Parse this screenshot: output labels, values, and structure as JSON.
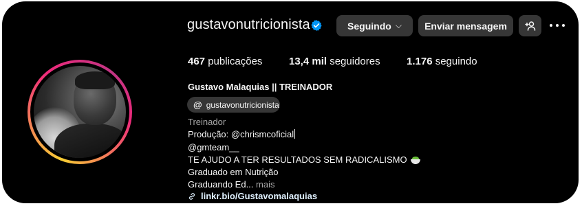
{
  "profile": {
    "username": "gustavonutricionista",
    "verified": true,
    "full_name": "Gustavo Malaquias || TREINADOR",
    "threads_handle": "gustavonutricionista",
    "category": "Treinador"
  },
  "actions": {
    "following_label": "Seguindo",
    "message_label": "Enviar mensagem",
    "suggest_icon": "add-person-icon",
    "more_icon": "more-options-icon"
  },
  "stats": {
    "posts_count": "467",
    "posts_label": "publicações",
    "followers_count": "13,4 mil",
    "followers_label": "seguidores",
    "following_count": "1.176",
    "following_label": "seguindo"
  },
  "bio": {
    "line1": "Produção: @chrismcoficial",
    "line2": "@gmteam__",
    "line3": "TE AJUDO A TER RESULTADOS SEM RADICALISMO",
    "line4": "Graduado em Nutrição",
    "line5": "Graduando Ed...",
    "more": "mais",
    "link": "linkr.bio/Gustavomalaquias"
  },
  "colors": {
    "background": "#000000",
    "button": "#363636",
    "verified_badge": "#0095f6",
    "secondary_text": "#a8a8a8",
    "link_text": "#e0f1ff"
  }
}
